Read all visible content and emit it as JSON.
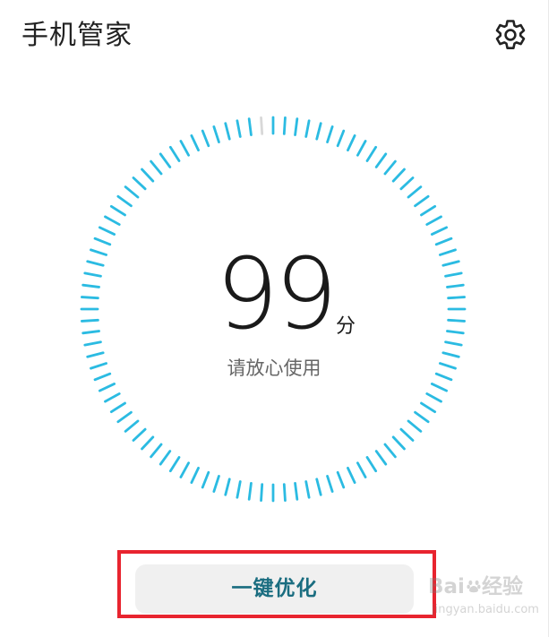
{
  "app": {
    "title": "手机管家"
  },
  "header": {
    "settings_icon": "gear-icon"
  },
  "score": {
    "value": "99",
    "unit": "分",
    "status": "请放心使用"
  },
  "actions": {
    "optimize_label": "一键优化"
  },
  "watermark": {
    "main": "Bai",
    "suffix": "经验",
    "sub": "jingyan.baidu.com"
  },
  "colors": {
    "dial_active": "#2bbbe2",
    "dial_inactive": "#d8d8d8",
    "button_text": "#1a6d80",
    "highlight": "#e8242f"
  }
}
